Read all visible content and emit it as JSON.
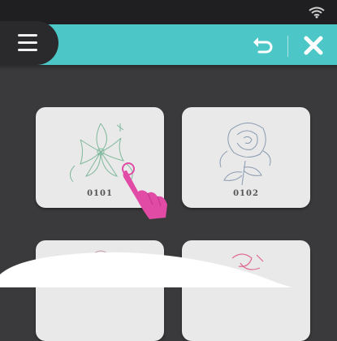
{
  "header": {
    "menu_icon": "hamburger-menu-icon",
    "back_icon": "return-arrow-icon",
    "close_icon": "close-x-icon",
    "accent_color": "#4cc6c6"
  },
  "status_bar": {
    "wifi_icon": "wifi-icon"
  },
  "designs": [
    {
      "label": "0101",
      "icon": "poinsettia-flower-design"
    },
    {
      "label": "0102",
      "icon": "rose-design"
    },
    {
      "label": "",
      "icon": "flower-design"
    },
    {
      "label": "",
      "icon": "pink-flower-design"
    }
  ],
  "pointer": {
    "icon": "pointing-hand-icon"
  }
}
